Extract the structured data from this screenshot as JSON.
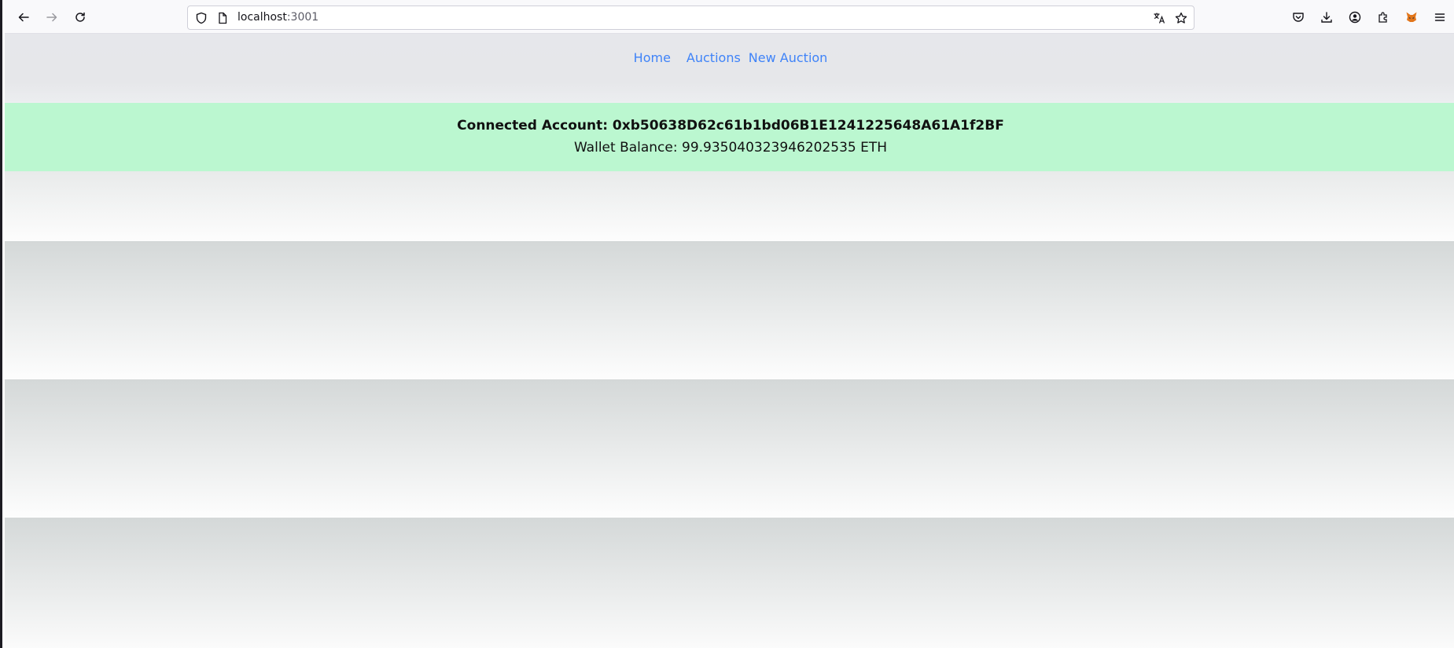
{
  "browser": {
    "url_host": "localhost",
    "url_port": ":3001",
    "icons": [
      "back-arrow-icon",
      "forward-arrow-icon",
      "reload-icon",
      "shield-icon",
      "page-icon",
      "translate-icon",
      "star-icon",
      "pocket-icon",
      "download-icon",
      "account-icon",
      "extensions-icon",
      "metamask-fox-icon",
      "menu-icon"
    ]
  },
  "nav": {
    "home": "Home",
    "auctions": "Auctions",
    "new_auction": "New Auction",
    "link_color": "#3f83f8"
  },
  "account": {
    "connected_label": "Connected Account: 0xb50638D62c61b1bd06B1E1241225648A61A1f2BF",
    "balance_label": "Wallet Balance: 99.935040323946202535 ETH",
    "banner_color": "#bbf7d0"
  }
}
